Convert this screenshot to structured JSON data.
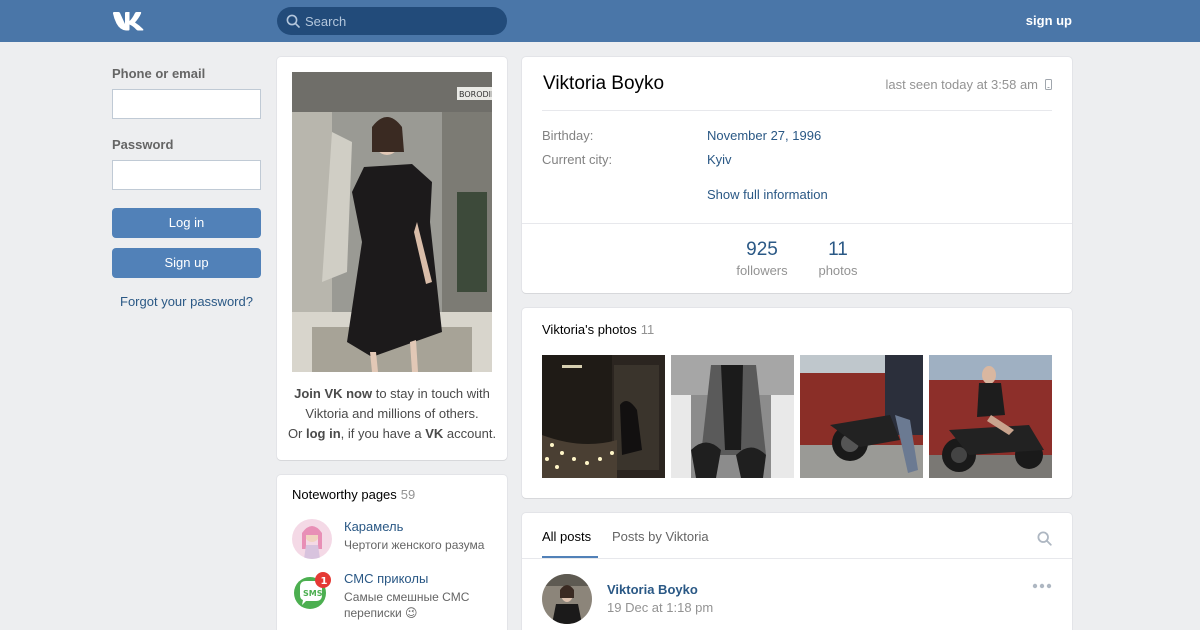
{
  "header": {
    "logo_icon": "vk-logo-icon",
    "search_placeholder": "Search",
    "signup_label": "sign up"
  },
  "login": {
    "phone_label": "Phone or email",
    "password_label": "Password",
    "login_button": "Log in",
    "signup_button": "Sign up",
    "forgot_link": "Forgot your password?"
  },
  "avatar_card": {
    "join_bold": "Join VK now",
    "join_rest": " to stay in touch with Viktoria and millions of others.",
    "or_text": "Or ",
    "log_in": "log in",
    "have_text": ", if you have a ",
    "vk": "VK",
    "account": " account.",
    "photo_watermark": "BORODIN"
  },
  "noteworthy": {
    "title": "Noteworthy pages",
    "count": "59",
    "items": [
      {
        "name": "Карамель",
        "desc": "Чертоги женского разума"
      },
      {
        "name": "СМС приколы",
        "desc": "Самые смешные СМС переписки 😉",
        "badge": "1"
      }
    ]
  },
  "profile": {
    "name": "Viktoria Boyko",
    "last_seen": "last seen today at 3:58 am",
    "birthday_label": "Birthday:",
    "birthday_value": "November 27, 1996",
    "city_label": "Current city:",
    "city_value": "Kyiv",
    "show_full": "Show full information",
    "stats": [
      {
        "num": "925",
        "label": "followers"
      },
      {
        "num": "11",
        "label": "photos"
      }
    ]
  },
  "photos": {
    "title": "Viktoria's photos",
    "count": "11"
  },
  "posts": {
    "tab_all": "All posts",
    "tab_by": "Posts by Viktoria",
    "author": "Viktoria Boyko",
    "date": "19 Dec at 1:18 pm"
  },
  "colors": {
    "brand": "#4a76a8",
    "link": "#2a5885",
    "button": "#5181b8"
  }
}
